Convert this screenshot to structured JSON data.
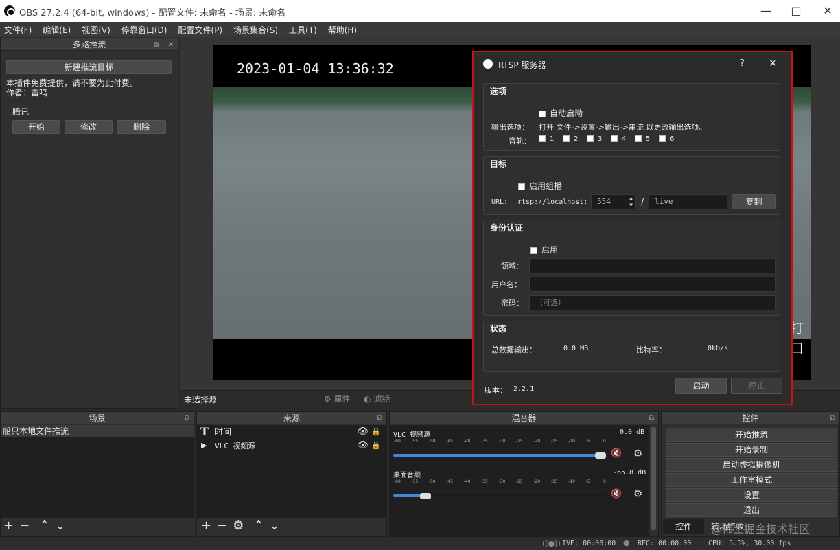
{
  "window": {
    "title": "OBS 27.2.4 (64-bit, windows) - 配置文件: 未命名 - 场景: 未命名"
  },
  "menu": [
    "文件(F)",
    "编辑(E)",
    "视图(V)",
    "停靠窗口(D)",
    "配置文件(P)",
    "场景集合(S)",
    "工具(T)",
    "帮助(H)"
  ],
  "multistream": {
    "title": "多路推流",
    "new_target": "新建推流目标",
    "note_line1": "本插件免费提供，请不要为此付费。",
    "note_line2": "作者：雷鸣",
    "target_name": "腾讯",
    "start": "开始",
    "edit": "修改",
    "delete": "删除"
  },
  "preview": {
    "timestamp": "2023-01-04  13:36:32",
    "overlay_text": "打口"
  },
  "source_toolbar": {
    "no_source": "未选择源",
    "properties": "属性",
    "filters": "滤镜"
  },
  "dialog": {
    "title": "RTSP 服务器",
    "help": "?",
    "options": {
      "title": "选项",
      "autostart": "自动启动",
      "output_label": "输出选项：",
      "output_text": "打开 文件->设置->输出->串流 以更改输出选项。",
      "audio_label": "音轨：",
      "tracks": [
        "1",
        "2",
        "3",
        "4",
        "5",
        "6"
      ]
    },
    "target": {
      "title": "目标",
      "multicast": "启用组播",
      "url_label": "URL:",
      "url_prefix": "rtsp://localhost:",
      "port": "554",
      "slash": "/",
      "path": "live",
      "copy": "复制"
    },
    "auth": {
      "title": "身份认证",
      "enable": "启用",
      "realm": "领域：",
      "username": "用户名：",
      "password": "密码：",
      "password_placeholder": "（可选）"
    },
    "status": {
      "title": "状态",
      "total_label": "总数据输出：",
      "total_value": "0.0 MB",
      "bitrate_label": "比特率：",
      "bitrate_value": "0kb/s"
    },
    "version_label": "版本：",
    "version": "2.2.1",
    "start": "启动",
    "stop": "停止"
  },
  "docks": {
    "scenes": {
      "title": "场景",
      "items": [
        "船只本地文件推流"
      ]
    },
    "sources": {
      "title": "来源",
      "items": [
        "时间",
        "VLC 视频源"
      ]
    },
    "mixer": {
      "title": "混音器",
      "channels": [
        {
          "name": "VLC 视频源",
          "db": "0.0 dB",
          "level": 1.0
        },
        {
          "name": "桌面音频",
          "db": "-65.8 dB",
          "level": 0.15
        }
      ],
      "scale": [
        "-60",
        "-55",
        "-50",
        "-45",
        "-40",
        "-35",
        "-30",
        "-25",
        "-20",
        "-15",
        "-10",
        "-5",
        "0"
      ]
    },
    "controls": {
      "title": "控件",
      "buttons": [
        "开始推流",
        "开始录制",
        "启动虚拟摄像机",
        "工作室模式",
        "设置",
        "退出"
      ],
      "tabs": [
        "控件",
        "转场特效"
      ]
    }
  },
  "statusbar": {
    "live": "LIVE: 00:00:00",
    "rec": "REC: 00:00:00",
    "cpu": "CPU: 5.5%, 30.00 fps"
  },
  "watermark": "@稀土掘金技术社区"
}
